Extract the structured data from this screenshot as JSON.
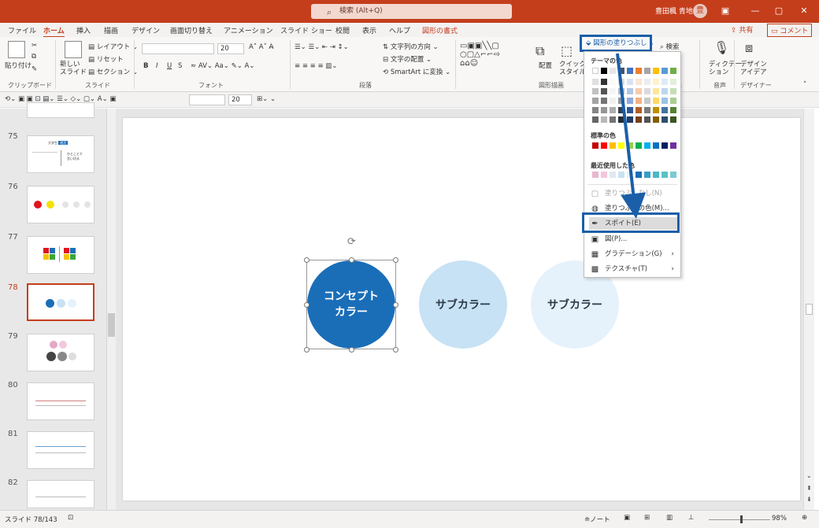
{
  "titlebar": {
    "search_placeholder": "検索 (Alt+Q)",
    "user_name": "豊田楓 青地",
    "avatar_initial": "豊",
    "minimize": "—",
    "restore": "▢",
    "close": "✕",
    "ribbon_display": "▣"
  },
  "menu_tabs": {
    "file": "ファイル",
    "home": "ホーム",
    "insert": "挿入",
    "draw": "描画",
    "design": "デザイン",
    "transitions": "画面切り替え",
    "animations": "アニメーション",
    "slideshow": "スライド ショー",
    "review": "校閲",
    "view": "表示",
    "help": "ヘルプ",
    "shape_format": "図形の書式",
    "share": "共有",
    "comment": "コメント"
  },
  "ribbon": {
    "paste": "貼り付け",
    "new_slide": "新しい\nスライド",
    "layout": "レイアウト",
    "reset": "リセット",
    "section": "セクション",
    "font_size": "20",
    "bold": "B",
    "italic": "I",
    "underline": "U",
    "strike": "S",
    "text_direction": "文字列の方向",
    "align_text": "文字の配置",
    "smartart": "SmartArt に変換",
    "arrange": "配置",
    "quick_style": "クイック\nスタイル",
    "fill_button": "図形の塗りつぶし",
    "find": "検索",
    "dictate": "ディクテー\nション",
    "designer": "デザイン\nアイデア",
    "groups": {
      "clipboard": "クリップボード",
      "slides": "スライド",
      "font": "フォント",
      "paragraph": "段落",
      "drawing": "図形描画",
      "edit": "集",
      "voice": "音声",
      "designer": "デザイナー"
    }
  },
  "qat": {
    "font_size": "20"
  },
  "thumbnails": [
    {
      "num": "75"
    },
    {
      "num": "76"
    },
    {
      "num": "77"
    },
    {
      "num": "78"
    },
    {
      "num": "79"
    },
    {
      "num": "80"
    },
    {
      "num": "81"
    },
    {
      "num": "82"
    }
  ],
  "thumb75": {
    "heading_a": "大学生",
    "heading_b": "就活",
    "right_a": "ひとことで",
    "right_b": "言い切る"
  },
  "slide": {
    "circle_main_line1": "コンセプト",
    "circle_main_line2": "カラー",
    "circle_sub1": "サブカラー",
    "circle_sub2": "サブカラー",
    "colors": {
      "main": "#1a6eb8",
      "sub1": "#c7e2f4",
      "sub2": "#e6f2fb"
    }
  },
  "dropdown": {
    "theme_colors": "テーマの色",
    "standard_colors": "標準の色",
    "recent_colors": "最近使用した色",
    "no_fill": "塗りつぶしなし(N)",
    "more_colors": "塗りつぶしの色(M)...",
    "eyedropper": "スポイト(E)",
    "picture": "図(P)...",
    "gradient": "グラデーション(G)",
    "texture": "テクスチャ(T)",
    "theme_top": [
      "#ffffff",
      "#000000",
      "#e7e6e6",
      "#44546a",
      "#4472c4",
      "#ed7d31",
      "#a5a5a5",
      "#ffc000",
      "#5b9bd5",
      "#70ad47"
    ],
    "standard": [
      "#c00000",
      "#ff0000",
      "#ffc000",
      "#ffff00",
      "#92d050",
      "#00b050",
      "#00b0f0",
      "#0070c0",
      "#002060",
      "#7030a0"
    ],
    "recent": [
      "#e6b8d0",
      "#f4c6dc",
      "#dfe9f5",
      "#c7e2f4",
      "#e6f2fb",
      "#1a6eb8",
      "#35a0c8",
      "#4bb8c4",
      "#5ac2c9",
      "#7bcbd3"
    ]
  },
  "status": {
    "slide_info": "スライド 78/143",
    "notes": "≘ノート",
    "zoom": "98%"
  }
}
